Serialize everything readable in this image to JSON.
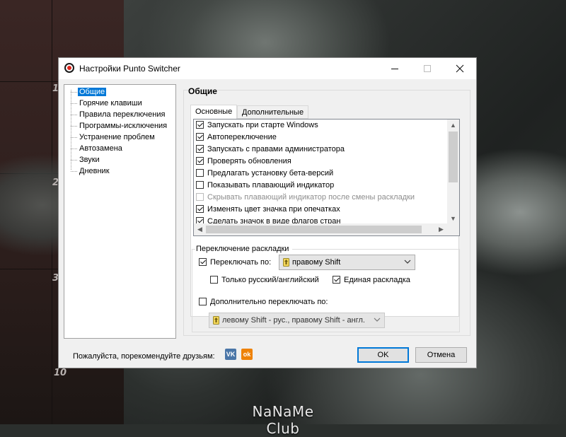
{
  "window": {
    "title": "Настройки Punto Switcher",
    "controls": {
      "minimize_icon": "minimize-icon",
      "maximize_icon": "maximize-icon",
      "close_icon": "close-icon"
    }
  },
  "sidebar": {
    "items": [
      {
        "label": "Общие",
        "selected": true
      },
      {
        "label": "Горячие клавиши"
      },
      {
        "label": "Правила переключения"
      },
      {
        "label": "Программы-исключения"
      },
      {
        "label": "Устранение проблем"
      },
      {
        "label": "Автозамена"
      },
      {
        "label": "Звуки"
      },
      {
        "label": "Дневник"
      }
    ]
  },
  "main": {
    "section_title": "Общие",
    "tabs": [
      {
        "label": "Основные",
        "active": true
      },
      {
        "label": "Дополнительные"
      }
    ],
    "options": [
      {
        "label": "Запускать при старте Windows",
        "checked": true
      },
      {
        "label": "Автопереключение",
        "checked": true
      },
      {
        "label": "Запускать с правами администратора",
        "checked": true
      },
      {
        "label": "Проверять обновления",
        "checked": true
      },
      {
        "label": "Предлагать установку бета-версий",
        "checked": false
      },
      {
        "label": "Показывать плавающий индикатор",
        "checked": false
      },
      {
        "label": "Скрывать плавающий индикатор после смены раскладки",
        "checked": false,
        "disabled": true
      },
      {
        "label": "Изменять цвет значка при опечатках",
        "checked": true
      },
      {
        "label": "Сделать значок в виде флагов стран",
        "checked": true
      }
    ],
    "layout_switch": {
      "group_title": "Переключение раскладки",
      "switch_by_label": "Переключать по:",
      "switch_by_checked": true,
      "switch_by_value": "правому Shift",
      "only_ru_en_label": "Только русский/английский",
      "only_ru_en_checked": false,
      "single_layout_label": "Единая раскладка",
      "single_layout_checked": true,
      "extra_switch_label": "Дополнительно переключать по:",
      "extra_switch_checked": false,
      "extra_switch_value": "левому Shift - рус., правому Shift - англ."
    }
  },
  "footer": {
    "recommend_text": "Пожалуйста, порекомендуйте друзьям:",
    "vk_label": "VK",
    "ok_label": "ok",
    "ok_button": "OK",
    "cancel_button": "Отмена"
  },
  "desktop": {
    "ruler_numbers": [
      "1",
      "2",
      "3",
      "10"
    ],
    "watermark": "NaNaMe Club"
  },
  "colors": {
    "accent": "#0078d7",
    "vk": "#4a76a8",
    "ok": "#ee8208",
    "app_icon_red": "#e0241b"
  }
}
